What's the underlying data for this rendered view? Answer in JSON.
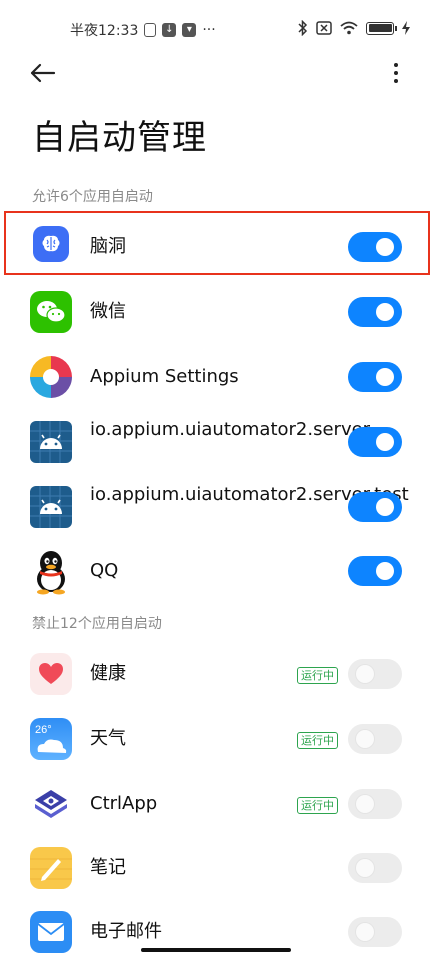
{
  "status_bar": {
    "time": "半夜12:33",
    "dots": "···"
  },
  "header": {
    "title": "自启动管理"
  },
  "sections": {
    "allowed_label": "允许6个应用自启动",
    "blocked_label": "禁止12个应用自启动"
  },
  "allowed_apps": [
    {
      "name": "脑洞",
      "icon": "brain-icon",
      "enabled": true
    },
    {
      "name": "微信",
      "icon": "wechat-icon",
      "enabled": true
    },
    {
      "name": "Appium Settings",
      "icon": "appium-icon",
      "enabled": true
    },
    {
      "name": "io.appium.uiautomator2.server",
      "icon": "android-icon",
      "enabled": true
    },
    {
      "name": "io.appium.uiautomator2.server.test",
      "icon": "android-icon",
      "enabled": true
    },
    {
      "name": "QQ",
      "icon": "qq-penguin-icon",
      "enabled": true
    }
  ],
  "blocked_apps": [
    {
      "name": "健康",
      "icon": "heart-icon",
      "badge": "运行中",
      "enabled": false
    },
    {
      "name": "天气",
      "icon": "weather-icon",
      "badge": "运行中",
      "enabled": false
    },
    {
      "name": "CtrlApp",
      "icon": "ctrlapp-icon",
      "badge": "运行中",
      "enabled": false
    },
    {
      "name": "笔记",
      "icon": "notes-icon",
      "enabled": false
    },
    {
      "name": "电子邮件",
      "icon": "mail-icon",
      "enabled": false
    }
  ],
  "weather_icon_text": "26°",
  "colors": {
    "toggle_on": "#0d84ff",
    "highlight": "#e8331c",
    "badge": "#2da44e"
  }
}
